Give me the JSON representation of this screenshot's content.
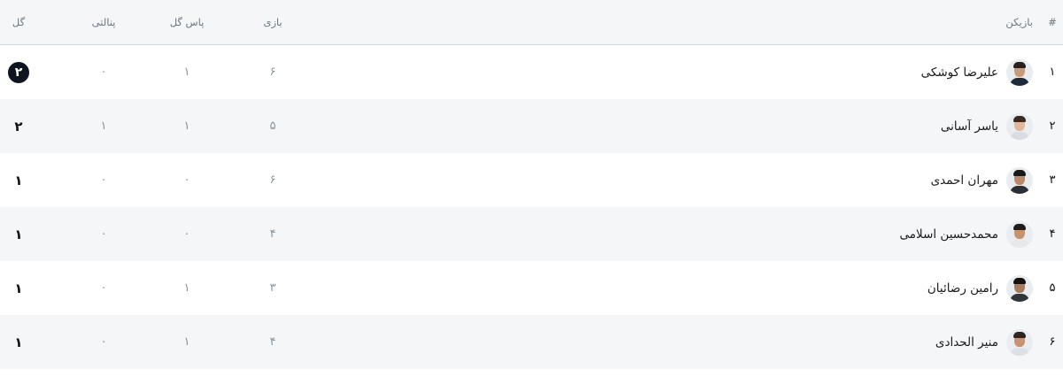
{
  "header": {
    "rank": "#",
    "player": "بازیکن",
    "games": "بازی",
    "assists": "پاس گل",
    "penalties": "پنالتی",
    "goals": "گل"
  },
  "rows": [
    {
      "rank": "۱",
      "name": "علیرضا کوشکی",
      "games": "۶",
      "assists": "۱",
      "penalties": "۰",
      "goals": "۲",
      "highlight": true
    },
    {
      "rank": "۲",
      "name": "یاسر آسانی",
      "games": "۵",
      "assists": "۱",
      "penalties": "۱",
      "goals": "۲",
      "highlight": false
    },
    {
      "rank": "۳",
      "name": "مهران احمدی",
      "games": "۶",
      "assists": "۰",
      "penalties": "۰",
      "goals": "۱",
      "highlight": false
    },
    {
      "rank": "۴",
      "name": "محمدحسین اسلامی",
      "games": "۴",
      "assists": "۰",
      "penalties": "۰",
      "goals": "۱",
      "highlight": false
    },
    {
      "rank": "۵",
      "name": "رامین رضائیان",
      "games": "۳",
      "assists": "۱",
      "penalties": "۰",
      "goals": "۱",
      "highlight": false
    },
    {
      "rank": "۶",
      "name": "منیر الحدادی",
      "games": "۴",
      "assists": "۱",
      "penalties": "۰",
      "goals": "۱",
      "highlight": false
    }
  ],
  "colors": {
    "header_bg": "#f5f6f8",
    "stripe_bg": "#f5f6f8",
    "muted_text": "#8a949d",
    "badge_bg": "#0f1520"
  }
}
